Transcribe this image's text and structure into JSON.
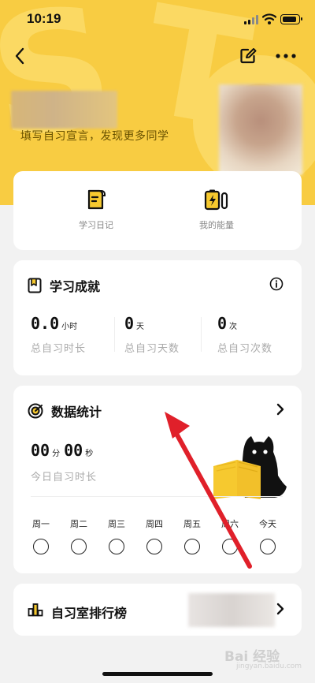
{
  "status_bar": {
    "time": "10:19"
  },
  "profile": {
    "slogan": "填写自习宣言，发现更多同学"
  },
  "shortcuts": [
    {
      "label": "学习日记",
      "icon": "diary-icon"
    },
    {
      "label": "我的能量",
      "icon": "battery-energy-icon"
    }
  ],
  "achievement": {
    "title": "学习成就",
    "stats": [
      {
        "value": "0.0",
        "unit": "小时",
        "label": "总自习时长"
      },
      {
        "value": "0",
        "unit": "天",
        "label": "总自习天数"
      },
      {
        "value": "0",
        "unit": "次",
        "label": "总自习次数"
      }
    ]
  },
  "data_stats": {
    "title": "数据统计",
    "minutes": "00",
    "minutes_unit": "分",
    "seconds": "00",
    "seconds_unit": "秒",
    "today_label": "今日自习时长",
    "week_days": [
      "周一",
      "周二",
      "周三",
      "周四",
      "周五",
      "周六",
      "今天"
    ]
  },
  "ranking": {
    "title": "自习室排行榜"
  },
  "watermark": {
    "main": "Bai 经验",
    "sub": "jingyan.baidu.com"
  },
  "colors": {
    "header": "#f8cc42",
    "accent_yellow": "#f6c92f",
    "arrow_red": "#e0202a"
  }
}
